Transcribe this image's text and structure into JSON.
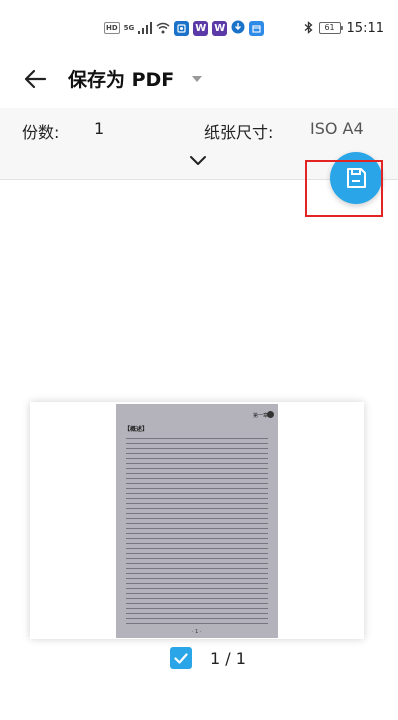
{
  "status_bar": {
    "hd": "HD",
    "network": "5G",
    "battery": "61",
    "time": "15:11",
    "app_icons": [
      "W",
      "W"
    ]
  },
  "header": {
    "title": "保存为 PDF"
  },
  "settings": {
    "copies_label": "份数:",
    "copies_value": "1",
    "paper_size_label": "纸张尺寸:",
    "paper_size_value": "ISO A4"
  },
  "preview": {
    "page_header": "第一章",
    "page_heading": "【概述】",
    "page_footer": "· 1 ·",
    "page_indicator": "1 / 1",
    "selected": true
  },
  "colors": {
    "accent": "#2aa6e8",
    "highlight_border": "#e22424"
  }
}
